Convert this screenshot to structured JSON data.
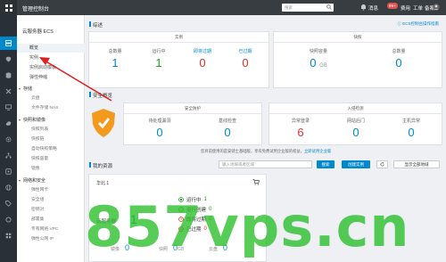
{
  "topbar": {
    "console_title": "管理控制台",
    "search_placeholder": "搜索",
    "messages_label": "消息",
    "messages_count": "99+",
    "billing_label": "费用",
    "tickets_label": "工单",
    "records_label": "备案"
  },
  "subnav": {
    "title": "云服务器 ECS",
    "items": [
      {
        "label": "概览",
        "active": true
      },
      {
        "label": "实例"
      },
      {
        "label": "实例启动模板"
      },
      {
        "label": "弹性伸缩"
      }
    ],
    "groups": [
      {
        "label": "存储",
        "children": [
          "云盘",
          "文件存储 NAS"
        ]
      },
      {
        "label": "快照和镜像",
        "children": [
          "快照列表",
          "快照链",
          "自动快照策略",
          "快照容量",
          "镜像"
        ]
      },
      {
        "label": "网络和安全",
        "children": [
          "弹性网卡",
          "安全组",
          "密钥对",
          "部署集",
          "专有网络 VPC",
          "弹性公网 IP"
        ]
      }
    ]
  },
  "overview": {
    "title": "综述",
    "event_link": "ECS控制台操作指南",
    "instance_panel": {
      "caption": "实例",
      "stats": [
        {
          "label": "总数量",
          "value": "1",
          "color": "#0088cc"
        },
        {
          "label": "运行中",
          "value": "1",
          "color": "#16a516"
        },
        {
          "label": "即将过期",
          "value": "0",
          "color": "#e0302e"
        },
        {
          "label": "已过期",
          "value": "0",
          "color": "#e0302e"
        }
      ]
    },
    "snapshot_panel": {
      "caption": "快照",
      "stats": [
        {
          "label": "快照容量",
          "value": "0",
          "unit": "GB",
          "color": "#0088cc"
        },
        {
          "label": "总数量",
          "value": "0",
          "color": "#0088cc"
        }
      ]
    }
  },
  "security": {
    "title": "安全概览",
    "protection_panel": {
      "caption": "安全防护",
      "stats": [
        {
          "label": "待处理漏洞",
          "value": "0"
        },
        {
          "label": "基线检查",
          "value": "0"
        }
      ]
    },
    "intrusion_panel": {
      "caption": "入侵检测",
      "stats": [
        {
          "label": "异常登录",
          "value": "6",
          "color": "#e0302e"
        },
        {
          "label": "网站后门",
          "value": "0"
        },
        {
          "label": "主机异常",
          "value": "0"
        }
      ]
    },
    "notice": "您目前使用的是安骑士基础版，享有免费试用企业版的权益，",
    "notice_link": "立即试用企业版"
  },
  "resources": {
    "title": "我的资源",
    "filter_placeholder": "输入地域或者区域",
    "search_btn": "搜索",
    "create_btn": "创建实例",
    "show_all_btn": "显示全部地域",
    "region_card": {
      "region": "华北 1",
      "server_label": "云服务器",
      "server_count": "1",
      "status": [
        {
          "label": "运行中",
          "value": "1",
          "color": "#16a516"
        },
        {
          "label": "运行创建",
          "value": "0",
          "color": "#16a516"
        },
        {
          "label": "即将过期",
          "value": "0",
          "color": "#e0302e"
        },
        {
          "label": "已过期",
          "value": "0",
          "color": "#e0302e"
        }
      ],
      "bottom": [
        {
          "label": "镜像",
          "value": "0"
        },
        {
          "label": "快照",
          "value": "0",
          "unit": "GB"
        },
        {
          "label": "云盘",
          "value": "0"
        }
      ]
    }
  },
  "watermark": "857vps.cn"
}
